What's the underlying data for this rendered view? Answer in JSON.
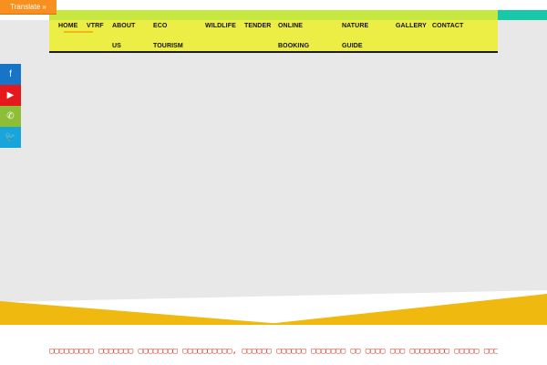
{
  "translate": {
    "label": "Translate »"
  },
  "nav": {
    "items": [
      {
        "label": "HOME",
        "active": true
      },
      {
        "label": "VTRF"
      },
      {
        "label": "ABOUT\nUS"
      },
      {
        "label": "ECO\nTOURISM"
      },
      {
        "label": "WILDLIFE"
      },
      {
        "label": "TENDER"
      },
      {
        "label": "ONLINE\nBOOKING"
      },
      {
        "label": "NATURE\nGUIDE"
      },
      {
        "label": "GALLERY"
      },
      {
        "label": "CONTACT"
      }
    ]
  },
  "social": {
    "items": [
      {
        "icon": "facebook-icon",
        "glyph": "f"
      },
      {
        "icon": "youtube-icon",
        "glyph": "▶"
      },
      {
        "icon": "whatsapp-icon",
        "glyph": "✆"
      },
      {
        "icon": "twitter-icon",
        "glyph": "🐦"
      }
    ]
  },
  "ticker": {
    "text": "▢▢▢▢▢▢▢▢▢ ▢▢▢▢▢▢▢ ▢▢▢▢▢▢▢▢ ▢▢▢▢▢▢▢▢▢▢, ▢▢▢▢▢▢ ▢▢▢▢▢▢ ▢▢▢▢▢▢▢ ▢▢ ▢▢▢▢ ▢▢▢ ▢▢▢▢▢▢▢▢ ▢▢▢▢▢ ▢▢▢▢▢▢"
  },
  "colors": {
    "navbar": "#eced45",
    "navbar_top": "#c7e840",
    "accent_teal": "#19c7a9",
    "hero_band": "#f0b90f",
    "hero_bg": "#e8e8e8",
    "translate": "#f7901e",
    "ticker_text": "#d8402e"
  }
}
